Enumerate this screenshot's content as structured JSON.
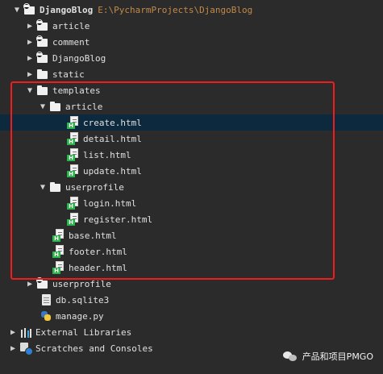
{
  "project_tree": {
    "root": {
      "label": "DjangoBlog",
      "path": "E:\\PycharmProjects\\DjangoBlog"
    },
    "items": [
      {
        "label": "article"
      },
      {
        "label": "comment"
      },
      {
        "label": "DjangoBlog"
      },
      {
        "label": "static"
      },
      {
        "label": "templates"
      },
      {
        "label": "article"
      },
      {
        "label": "create.html"
      },
      {
        "label": "detail.html"
      },
      {
        "label": "list.html"
      },
      {
        "label": "update.html"
      },
      {
        "label": "userprofile"
      },
      {
        "label": "login.html"
      },
      {
        "label": "register.html"
      },
      {
        "label": "base.html"
      },
      {
        "label": "footer.html"
      },
      {
        "label": "header.html"
      },
      {
        "label": "userprofile"
      },
      {
        "label": "db.sqlite3"
      },
      {
        "label": "manage.py"
      },
      {
        "label": "External Libraries"
      },
      {
        "label": "Scratches and Consoles"
      }
    ],
    "selected_item": "create.html"
  },
  "html_badge": "H",
  "watermark": {
    "text": "产品和项目PMGO",
    "icon": "wechat-icon"
  },
  "colors": {
    "background": "#2b2b2b",
    "selected_row": "#0d293e",
    "highlight_border": "#f21c1c",
    "path_text": "#c08a4b",
    "html_badge": "#2cb44b"
  }
}
